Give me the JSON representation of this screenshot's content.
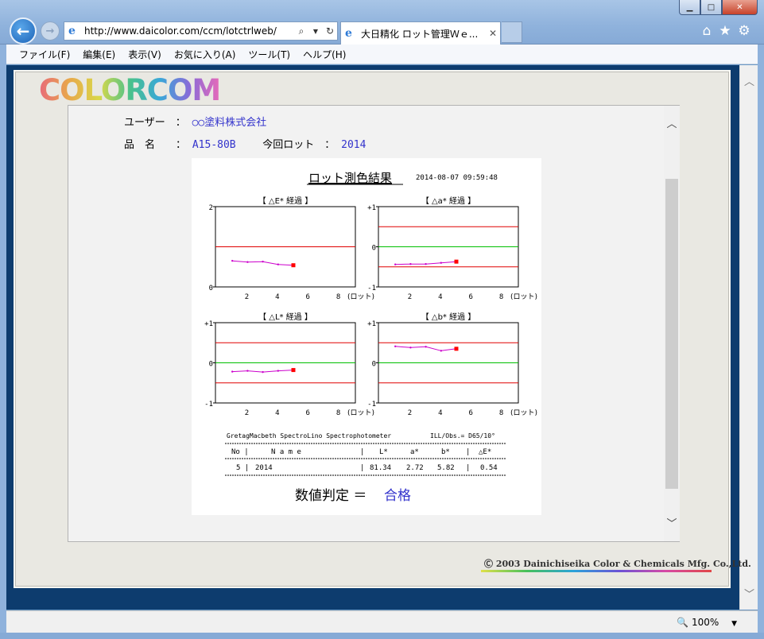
{
  "window": {
    "minimize_glyph": "▁",
    "maximize_glyph": "□",
    "close_glyph": "✕"
  },
  "nav": {
    "address_url": "http://www.daicolor.com/ccm/lotctrlweb/",
    "tab_title": "大日精化 ロット管理Ｗｅ...",
    "back_icon": "arrow-left-icon",
    "forward_icon": "arrow-right-icon"
  },
  "menubar": [
    "ファイル(F)",
    "編集(E)",
    "表示(V)",
    "お気に入り(A)",
    "ツール(T)",
    "ヘルプ(H)"
  ],
  "logo": "COLORCOM",
  "info": {
    "user_label": "ユーザー　：",
    "user_value": "○○塗料株式会社",
    "product_label": "品　名　　：",
    "product_value": "A15-80B",
    "lot_label": "今回ロット　：",
    "lot_value": "2014"
  },
  "report": {
    "title": "ロット測色結果",
    "timestamp": "2014-08-07 09:59:48",
    "instrument": "GretagMacbeth SpectroLino Spectrophotometer",
    "illuminant": "ILL/Obs.= D65/10°",
    "table": {
      "headers": [
        "No |",
        "N a m e",
        "|",
        "L*",
        "a*",
        "b*",
        "|",
        "△E*"
      ],
      "row": [
        "5 |",
        "2014",
        "|",
        "81.34",
        "2.72",
        "5.82",
        "|",
        "0.54"
      ]
    },
    "judgement_label": "数値判定 ＝",
    "judgement_value": "合格",
    "colors": {
      "limit": "#e00000",
      "center": "#00c000",
      "series": "#cc00cc",
      "last_point": "#ff0000",
      "judgement": "#3333cc"
    }
  },
  "chart_data": [
    {
      "type": "line",
      "title": "【 △E* 経過 】",
      "xlabel": "(ロット)",
      "xticks": [
        2,
        4,
        6,
        8
      ],
      "yticks": [
        "2",
        "0"
      ],
      "xlim": [
        0,
        10
      ],
      "ylim": [
        0,
        2
      ],
      "limits": [
        1.0
      ],
      "center": null,
      "series": [
        {
          "x": [
            1,
            2,
            3,
            4,
            5
          ],
          "y": [
            0.65,
            0.62,
            0.63,
            0.56,
            0.54
          ]
        }
      ]
    },
    {
      "type": "line",
      "title": "【 △a* 経過 】",
      "xlabel": "(ロット)",
      "xticks": [
        2,
        4,
        6,
        8
      ],
      "yticks": [
        "+1",
        "0",
        "-1"
      ],
      "xlim": [
        0,
        10
      ],
      "ylim": [
        -1,
        1
      ],
      "limits": [
        0.5,
        -0.5
      ],
      "center": 0,
      "series": [
        {
          "x": [
            1,
            2,
            3,
            4,
            5
          ],
          "y": [
            -0.44,
            -0.43,
            -0.43,
            -0.4,
            -0.37
          ]
        }
      ]
    },
    {
      "type": "line",
      "title": "【 △L* 経過 】",
      "xlabel": "(ロット)",
      "xticks": [
        2,
        4,
        6,
        8
      ],
      "yticks": [
        "+1",
        "0",
        "-1"
      ],
      "xlim": [
        0,
        10
      ],
      "ylim": [
        -1,
        1
      ],
      "limits": [
        0.5,
        -0.5
      ],
      "center": 0,
      "series": [
        {
          "x": [
            1,
            2,
            3,
            4,
            5
          ],
          "y": [
            -0.22,
            -0.2,
            -0.23,
            -0.2,
            -0.18
          ]
        }
      ]
    },
    {
      "type": "line",
      "title": "【 △b* 経過 】",
      "xlabel": "(ロット)",
      "xticks": [
        2,
        4,
        6,
        8
      ],
      "yticks": [
        "+1",
        "0",
        "-1"
      ],
      "xlim": [
        0,
        10
      ],
      "ylim": [
        -1,
        1
      ],
      "limits": [
        0.5,
        -0.5
      ],
      "center": 0,
      "series": [
        {
          "x": [
            1,
            2,
            3,
            4,
            5
          ],
          "y": [
            0.41,
            0.38,
            0.4,
            0.3,
            0.35
          ]
        }
      ]
    }
  ],
  "copyright": "Ⓒ 2003 Dainichiseika Color & Chemicals Mfg. Co.,Ltd.",
  "status": {
    "zoom": "100%"
  }
}
